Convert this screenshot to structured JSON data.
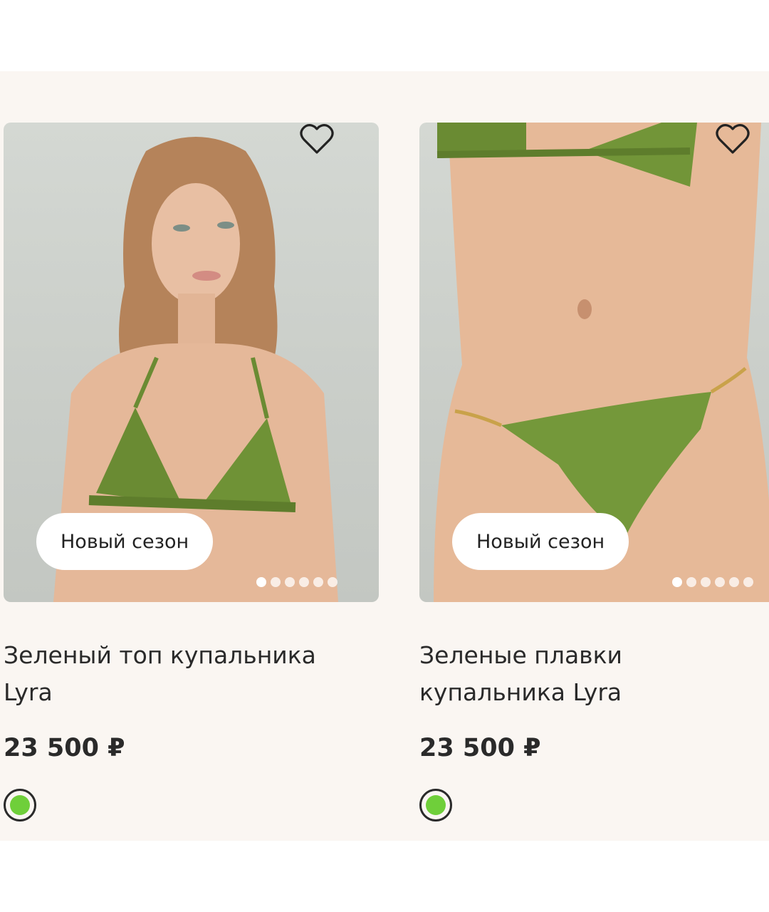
{
  "products": [
    {
      "badge": "Новый сезон",
      "title": "Зеленый топ купальника Lyra",
      "price": "23 500 ₽",
      "favorite_icon": "heart-outline-icon",
      "swatch_color": "#6fcf3a",
      "images_total": 6,
      "image_active": 1
    },
    {
      "badge": "Новый сезон",
      "title": "Зеленые плавки купальника Lyra",
      "price": "23 500 ₽",
      "favorite_icon": "heart-outline-icon",
      "swatch_color": "#6fcf3a",
      "images_total": 6,
      "image_active": 1
    }
  ]
}
